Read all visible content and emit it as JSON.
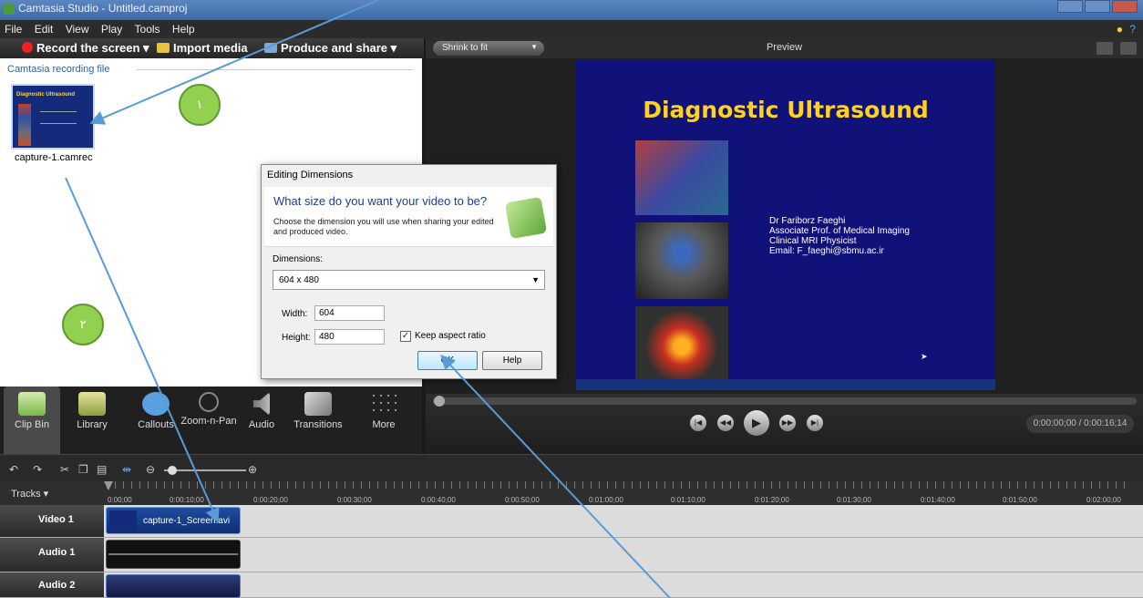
{
  "window": {
    "title": "Camtasia Studio - Untitled.camproj"
  },
  "menu": [
    "File",
    "Edit",
    "View",
    "Play",
    "Tools",
    "Help"
  ],
  "toolbar": {
    "record": "Record the screen",
    "import": "Import media",
    "produce": "Produce and share"
  },
  "clip_bin": {
    "section": "Camtasia recording file",
    "thumb_title": "Diagnostic Ultrasound",
    "file_label": "capture-1.camrec"
  },
  "preview": {
    "zoom": "Shrink to fit",
    "title": "Preview",
    "slide_title": "Diagnostic Ultrasound",
    "slide_lines": [
      "Dr Fariborz Faeghi",
      "Associate Prof. of Medical Imaging",
      "Clinical MRI Physicist",
      "Email: F_faeghi@sbmu.ac.ir"
    ]
  },
  "dialog": {
    "title": "Editing Dimensions",
    "question": "What size do you want your video to be?",
    "description": "Choose the dimension you will use when sharing your edited and produced video.",
    "dims_label": "Dimensions:",
    "dims_value": "604 x 480",
    "width_label": "Width:",
    "width_value": "604",
    "height_label": "Height:",
    "height_value": "480",
    "keep_aspect": "Keep aspect ratio",
    "ok": "OK",
    "help": "Help"
  },
  "tabs": [
    "Clip Bin",
    "Library",
    "Callouts",
    "Zoom-n-Pan",
    "Audio",
    "Transitions",
    "More"
  ],
  "player": {
    "time": "0:00:00;00 / 0:00:16;14"
  },
  "timeline": {
    "tracks_label": "Tracks",
    "ticks": [
      "0:00;00",
      "0:00:10;00",
      "0:00:20;00",
      "0:00:30;00",
      "0:00:40;00",
      "0:00:50;00",
      "0:01:00;00",
      "0:01:10;00",
      "0:01:20;00",
      "0:01:30;00",
      "0:01:40;00",
      "0:01:50;00",
      "0:02:00;00"
    ],
    "track_names": [
      "Video 1",
      "Audio 1",
      "Audio 2"
    ],
    "video_clip": "capture-1_Screen.avi"
  },
  "badges": [
    "١",
    "٢"
  ],
  "colors": {
    "badge": "#92d050",
    "arrow": "#5b9bd5",
    "slide_bg": "#11117a",
    "slide_title": "#ffd21f"
  }
}
